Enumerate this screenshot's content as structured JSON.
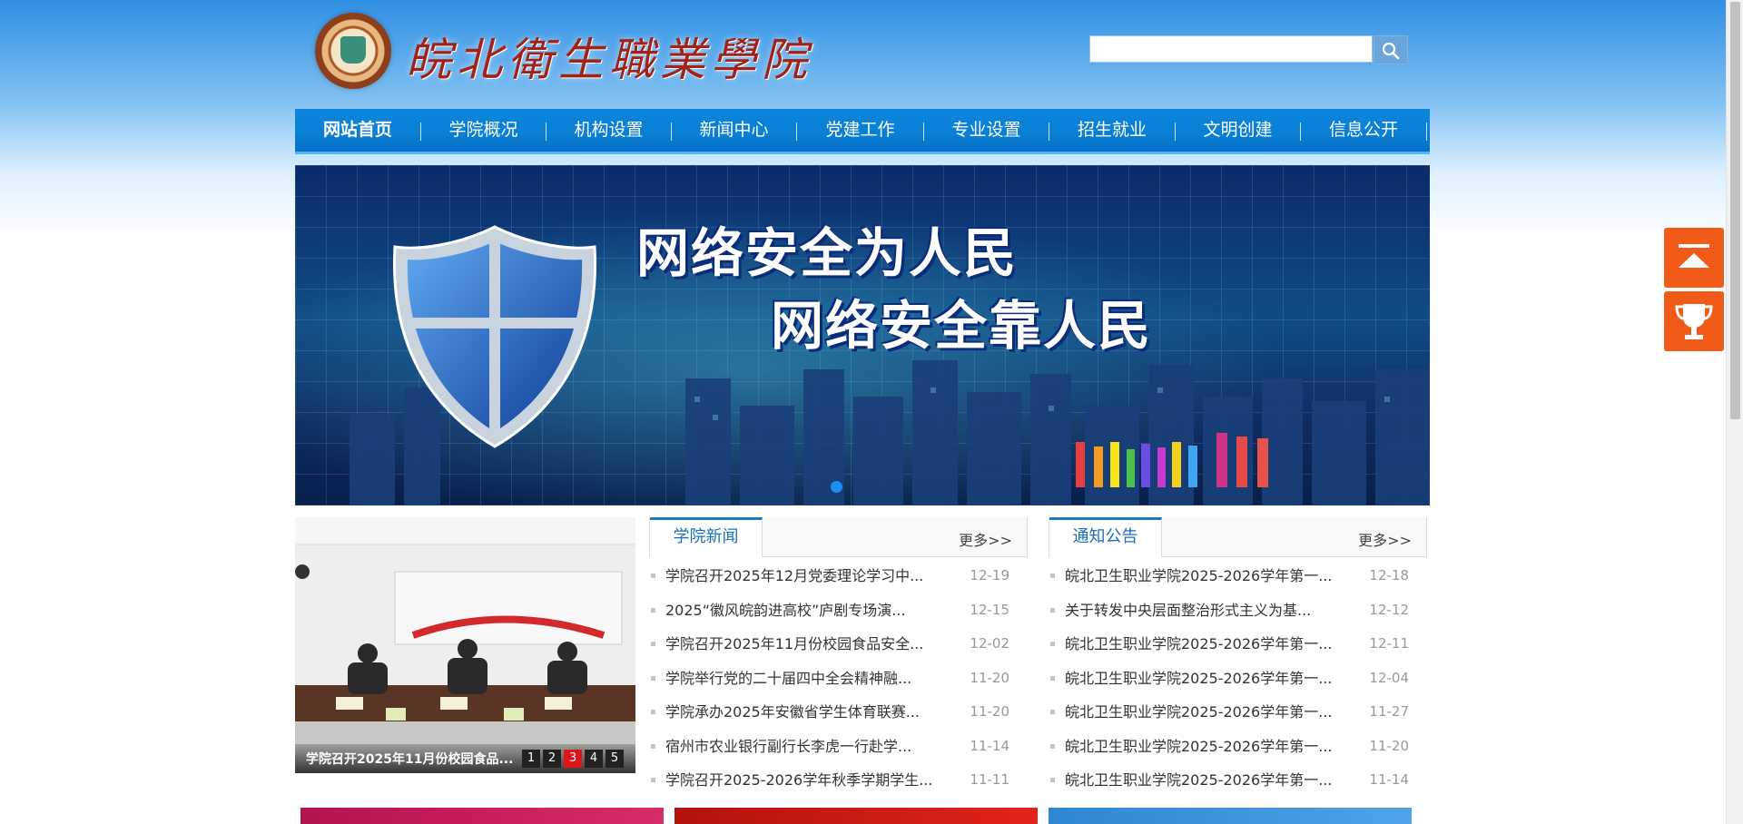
{
  "header": {
    "brand_text": "皖北衛生職業學院",
    "search": {
      "placeholder": ""
    }
  },
  "nav": {
    "items": [
      {
        "label": "网站首页",
        "active": true
      },
      {
        "label": "学院概况"
      },
      {
        "label": "机构设置"
      },
      {
        "label": "新闻中心"
      },
      {
        "label": "党建工作"
      },
      {
        "label": "专业设置"
      },
      {
        "label": "招生就业"
      },
      {
        "label": "文明创建"
      },
      {
        "label": "信息公开"
      }
    ]
  },
  "banner": {
    "line1": "网络安全为人民",
    "line2": "网络安全靠人民"
  },
  "photo_slider": {
    "caption": "学院召开2025年11月份校园食品...",
    "pages": [
      "1",
      "2",
      "3",
      "4",
      "5"
    ],
    "active_page": "3"
  },
  "college_news": {
    "title": "学院新闻",
    "more": "更多>>",
    "items": [
      {
        "text": "学院召开2025年12月党委理论学习中...",
        "date": "12-19"
      },
      {
        "text": "2025“徽风皖韵进高校”庐剧专场演...",
        "date": "12-15"
      },
      {
        "text": "学院召开2025年11月份校园食品安全...",
        "date": "12-02"
      },
      {
        "text": "学院举行党的二十届四中全会精神融...",
        "date": "11-20"
      },
      {
        "text": "学院承办2025年安徽省学生体育联赛...",
        "date": "11-20"
      },
      {
        "text": "宿州市农业银行副行长李虎一行赴学...",
        "date": "11-14"
      },
      {
        "text": "学院召开2025-2026学年秋季学期学生...",
        "date": "11-11"
      }
    ]
  },
  "notices": {
    "title": "通知公告",
    "more": "更多>>",
    "items": [
      {
        "text": "皖北卫生职业学院2025-2026学年第一...",
        "date": "12-18"
      },
      {
        "text": "关于转发中央层面整治形式主义为基...",
        "date": "12-12"
      },
      {
        "text": "皖北卫生职业学院2025-2026学年第一...",
        "date": "12-11"
      },
      {
        "text": "皖北卫生职业学院2025-2026学年第一...",
        "date": "12-04"
      },
      {
        "text": "皖北卫生职业学院2025-2026学年第一...",
        "date": "11-27"
      },
      {
        "text": "皖北卫生职业学院2025-2026学年第一...",
        "date": "11-20"
      },
      {
        "text": "皖北卫生职业学院2025-2026学年第一...",
        "date": "11-14"
      }
    ]
  },
  "colors": {
    "nav_bg": "#0a7fd4",
    "accent": "#1c6eb9",
    "float_btn": "#f25a17",
    "pager_active": "#e0141b"
  },
  "float_buttons": [
    {
      "icon": "back-to-top-icon"
    },
    {
      "icon": "trophy-icon"
    }
  ]
}
